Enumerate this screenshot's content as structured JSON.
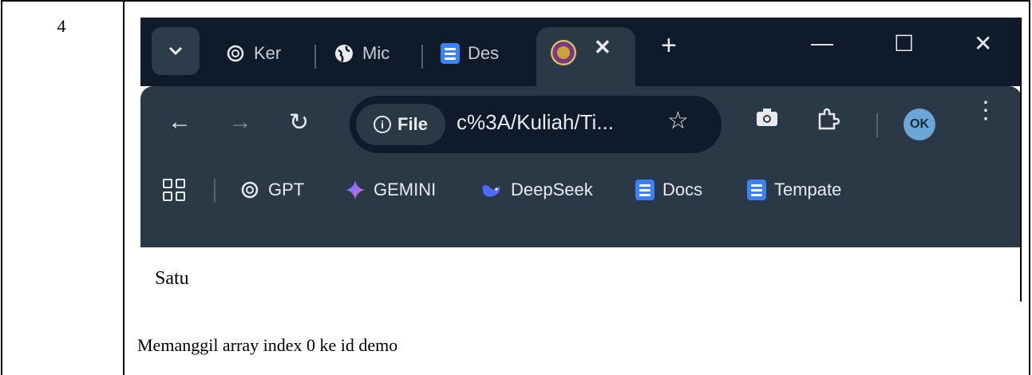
{
  "document": {
    "row_number": "4",
    "caption": "Memanggil array index 0 ke id demo"
  },
  "browser": {
    "tabs": [
      {
        "label": "Ker",
        "icon": "openai-icon"
      },
      {
        "label": "Mic",
        "icon": "globe-icon"
      },
      {
        "label": "Des",
        "icon": "docs-icon"
      }
    ],
    "active_tab_icon": "university-logo-icon",
    "window_controls": {
      "minimize": "—",
      "maximize": "☐",
      "close": "✕"
    },
    "omnibox": {
      "security_chip": "File",
      "url": "c%3A/Kuliah/Ti..."
    },
    "profile_initials": "OK",
    "bookmarks": [
      {
        "label": "GPT",
        "icon": "openai-icon"
      },
      {
        "label": "GEMINI",
        "icon": "gemini-icon"
      },
      {
        "label": "DeepSeek",
        "icon": "deepseek-icon"
      },
      {
        "label": "Docs",
        "icon": "docs-icon"
      },
      {
        "label": "Tempate",
        "icon": "docs-icon"
      }
    ],
    "page_text": "Satu"
  },
  "colors": {
    "tabstrip_bg": "#0f1b2a",
    "toolbar_bg": "#2b3846",
    "docs_blue": "#3b82f6"
  }
}
